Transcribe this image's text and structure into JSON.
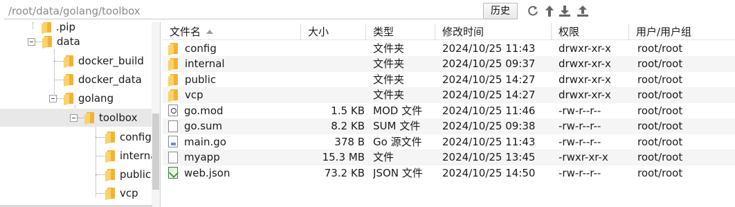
{
  "pathbar": {
    "path": "/root/data/golang/toolbox",
    "history_label": "历史"
  },
  "toolbar_icons": [
    "refresh-icon",
    "up-arrow-icon",
    "download-icon",
    "upload-icon"
  ],
  "tree": {
    "nodes": [
      {
        "label": ".pip",
        "depth": 2
      },
      {
        "label": "data",
        "depth": 1,
        "expanded": true
      },
      {
        "label": "docker_build",
        "depth": 2
      },
      {
        "label": "docker_data",
        "depth": 2
      },
      {
        "label": "golang",
        "depth": 2,
        "expanded": true
      },
      {
        "label": "toolbox",
        "depth": 3,
        "expanded": true,
        "selected": true
      },
      {
        "label": "config",
        "depth": 4
      },
      {
        "label": "internal",
        "depth": 4
      },
      {
        "label": "public",
        "depth": 4
      },
      {
        "label": "vcp",
        "depth": 4
      }
    ]
  },
  "list": {
    "columns": {
      "name": "文件名",
      "size": "大小",
      "type": "类型",
      "modified": "修改时间",
      "permissions": "权限",
      "owner": "用户/用户组"
    },
    "rows": [
      {
        "icon": "folder-icon",
        "name": "config",
        "size": "",
        "type": "文件夹",
        "modified": "2024/10/25 11:43",
        "permissions": "drwxr-xr-x",
        "owner": "root/root"
      },
      {
        "icon": "folder-icon",
        "name": "internal",
        "size": "",
        "type": "文件夹",
        "modified": "2024/10/25 09:37",
        "permissions": "drwxr-xr-x",
        "owner": "root/root"
      },
      {
        "icon": "folder-icon",
        "name": "public",
        "size": "",
        "type": "文件夹",
        "modified": "2024/10/25 14:27",
        "permissions": "drwxr-xr-x",
        "owner": "root/root"
      },
      {
        "icon": "folder-icon",
        "name": "vcp",
        "size": "",
        "type": "文件夹",
        "modified": "2024/10/25 14:27",
        "permissions": "drwxr-xr-x",
        "owner": "root/root"
      },
      {
        "icon": "mod-file-icon",
        "name": "go.mod",
        "size": "1.5 KB",
        "type": "MOD 文件",
        "modified": "2024/10/25 11:46",
        "permissions": "-rw-r--r--",
        "owner": "root/root"
      },
      {
        "icon": "file-icon",
        "name": "go.sum",
        "size": "8.2 KB",
        "type": "SUM 文件",
        "modified": "2024/10/25 09:38",
        "permissions": "-rw-r--r--",
        "owner": "root/root"
      },
      {
        "icon": "go-file-icon",
        "name": "main.go",
        "size": "378 B",
        "type": "Go 源文件",
        "modified": "2024/10/25 11:43",
        "permissions": "-rw-r--r--",
        "owner": "root/root"
      },
      {
        "icon": "file-icon",
        "name": "myapp",
        "size": "15.3 MB",
        "type": "文件",
        "modified": "2024/10/25 13:45",
        "permissions": "-rwxr-xr-x",
        "owner": "root/root"
      },
      {
        "icon": "json-file-icon",
        "name": "web.json",
        "size": "73.2 KB",
        "type": "JSON 文件",
        "modified": "2024/10/25 14:50",
        "permissions": "-rw-r--r--",
        "owner": "root/root"
      }
    ]
  }
}
